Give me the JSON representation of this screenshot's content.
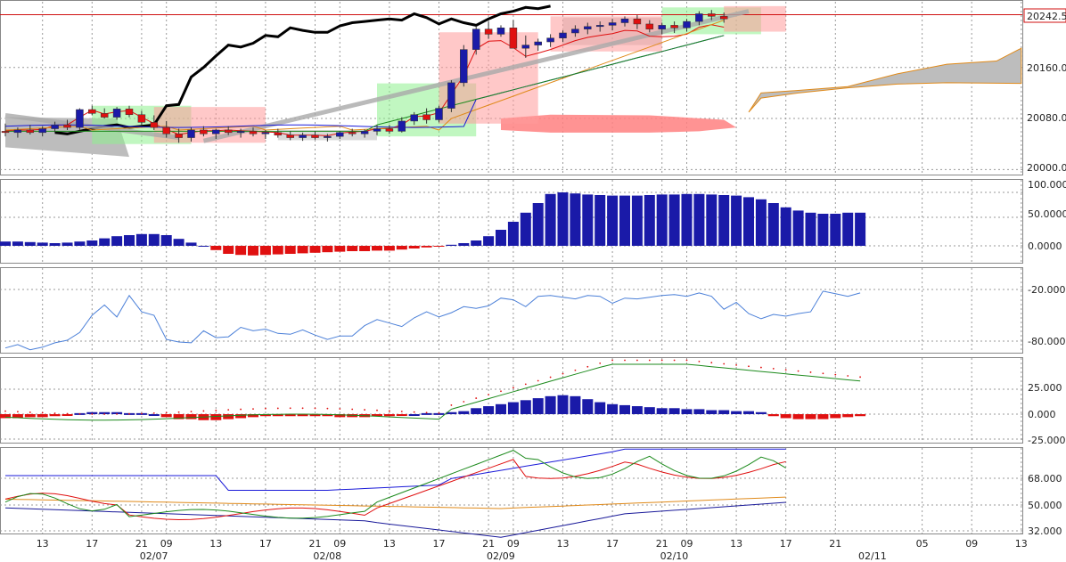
{
  "colors": {
    "up_bar": "#1a1aa8",
    "down_bar": "#e01010",
    "grid": "#9a9a9a",
    "price_line": "#000000",
    "current_price_line": "#d01010",
    "cloud_gray": "#bdbdbd",
    "cloud_red": "#ff8080",
    "box_green": "#8ef08e",
    "box_red": "#ff9a9a",
    "box_gray": "#bcbcbc",
    "osc_line": "#4a7fd8",
    "green_line": "#1c8a1c",
    "red_line": "#e01010",
    "orange_line": "#e08a1a",
    "blue_line": "#1a1ad8"
  },
  "price_scale": {
    "labels": [
      "20242.5",
      "20160.0",
      "20080.0",
      "20000.0"
    ],
    "current_price": "20242.5"
  },
  "time_axis": {
    "ticks": [
      {
        "idx": 3,
        "label": "13"
      },
      {
        "idx": 7,
        "label": "17"
      },
      {
        "idx": 11,
        "label": "21"
      },
      {
        "idx": 13,
        "label": "09"
      },
      {
        "idx": 17,
        "label": "13"
      },
      {
        "idx": 21,
        "label": "17"
      },
      {
        "idx": 25,
        "label": "21"
      },
      {
        "idx": 27,
        "label": "09"
      },
      {
        "idx": 31,
        "label": "13"
      },
      {
        "idx": 35,
        "label": "17"
      },
      {
        "idx": 39,
        "label": "21"
      },
      {
        "idx": 41,
        "label": "09"
      },
      {
        "idx": 45,
        "label": "13"
      },
      {
        "idx": 49,
        "label": "17"
      },
      {
        "idx": 53,
        "label": "21"
      },
      {
        "idx": 55,
        "label": "09"
      },
      {
        "idx": 59,
        "label": "13"
      },
      {
        "idx": 63,
        "label": "17"
      },
      {
        "idx": 67,
        "label": "21"
      },
      {
        "idx": 74,
        "label": "05"
      },
      {
        "idx": 78,
        "label": "09"
      },
      {
        "idx": 82,
        "label": "13"
      }
    ],
    "dates": [
      {
        "idx": 12,
        "label": "02/07"
      },
      {
        "idx": 26,
        "label": "02/08"
      },
      {
        "idx": 40,
        "label": "02/09"
      },
      {
        "idx": 54,
        "label": "02/10"
      },
      {
        "idx": 70,
        "label": "02/11"
      }
    ]
  },
  "panels": {
    "macd_hist": {
      "labels": [
        "100.000",
        "50.0000",
        "0.0000"
      ]
    },
    "williams": {
      "labels": [
        "-20.000",
        "-80.000"
      ]
    },
    "dmi": {
      "labels": [
        "25.000",
        "0.000",
        "-25.000"
      ]
    },
    "rsi_multi": {
      "labels": [
        "68.000",
        "50.000",
        "32.000"
      ]
    }
  },
  "chart_data": [
    {
      "type": "candlestick",
      "y_range": [
        19995,
        20260
      ],
      "current_price": 20242.5,
      "ohlc": [
        [
          20060,
          20072,
          20052,
          20058
        ],
        [
          20058,
          20066,
          20050,
          20062
        ],
        [
          20062,
          20070,
          20055,
          20058
        ],
        [
          20058,
          20068,
          20052,
          20064
        ],
        [
          20064,
          20075,
          20058,
          20070
        ],
        [
          20070,
          20078,
          20062,
          20066
        ],
        [
          20066,
          20096,
          20062,
          20094
        ],
        [
          20094,
          20100,
          20085,
          20088
        ],
        [
          20088,
          20096,
          20080,
          20082
        ],
        [
          20082,
          20098,
          20078,
          20095
        ],
        [
          20095,
          20100,
          20082,
          20086
        ],
        [
          20086,
          20092,
          20070,
          20074
        ],
        [
          20074,
          20085,
          20062,
          20066
        ],
        [
          20066,
          20076,
          20050,
          20056
        ],
        [
          20056,
          20064,
          20042,
          20050
        ],
        [
          20050,
          20066,
          20044,
          20062
        ],
        [
          20062,
          20068,
          20052,
          20056
        ],
        [
          20056,
          20064,
          20048,
          20062
        ],
        [
          20062,
          20068,
          20054,
          20058
        ],
        [
          20058,
          20064,
          20050,
          20060
        ],
        [
          20060,
          20066,
          20052,
          20056
        ],
        [
          20056,
          20062,
          20048,
          20058
        ],
        [
          20058,
          20064,
          20050,
          20054
        ],
        [
          20054,
          20060,
          20046,
          20050
        ],
        [
          20050,
          20058,
          20045,
          20054
        ],
        [
          20054,
          20060,
          20047,
          20050
        ],
        [
          20050,
          20056,
          20044,
          20052
        ],
        [
          20052,
          20060,
          20048,
          20058
        ],
        [
          20058,
          20064,
          20052,
          20056
        ],
        [
          20056,
          20063,
          20050,
          20060
        ],
        [
          20060,
          20070,
          20054,
          20064
        ],
        [
          20064,
          20070,
          20056,
          20060
        ],
        [
          20060,
          20082,
          20058,
          20076
        ],
        [
          20076,
          20090,
          20070,
          20086
        ],
        [
          20086,
          20096,
          20072,
          20078
        ],
        [
          20078,
          20100,
          20074,
          20096
        ],
        [
          20096,
          20140,
          20090,
          20136
        ],
        [
          20136,
          20195,
          20130,
          20188
        ],
        [
          20188,
          20225,
          20180,
          20220
        ],
        [
          20220,
          20232,
          20205,
          20212
        ],
        [
          20212,
          20226,
          20208,
          20222
        ],
        [
          20222,
          20234,
          20205,
          20190
        ],
        [
          20190,
          20210,
          20175,
          20195
        ],
        [
          20195,
          20205,
          20186,
          20200
        ],
        [
          20200,
          20212,
          20192,
          20206
        ],
        [
          20206,
          20218,
          20200,
          20214
        ],
        [
          20214,
          20226,
          20208,
          20220
        ],
        [
          20220,
          20230,
          20212,
          20224
        ],
        [
          20224,
          20232,
          20216,
          20226
        ],
        [
          20226,
          20236,
          20218,
          20230
        ],
        [
          20230,
          20240,
          20224,
          20236
        ],
        [
          20236,
          20242,
          20220,
          20228
        ],
        [
          20228,
          20234,
          20215,
          20220
        ],
        [
          20220,
          20230,
          20212,
          20226
        ],
        [
          20226,
          20232,
          20214,
          20222
        ],
        [
          20222,
          20236,
          20216,
          20232
        ],
        [
          20232,
          20248,
          20226,
          20244
        ],
        [
          20244,
          20250,
          20234,
          20240
        ],
        [
          20240,
          20246,
          20230,
          20236
        ]
      ]
    },
    {
      "type": "bar",
      "name_ref": "macd_hist",
      "y_range": [
        -25,
        105
      ],
      "values": [
        8,
        8,
        7,
        6,
        5,
        6,
        8,
        10,
        14,
        18,
        20,
        22,
        22,
        20,
        13,
        6,
        0,
        -8,
        -15,
        -17,
        -18,
        -17,
        -16,
        -15,
        -14,
        -13,
        -12,
        -11,
        -10,
        -10,
        -9,
        -9,
        -7,
        -5,
        -3,
        -1,
        2,
        5,
        10,
        18,
        30,
        45,
        62,
        80,
        97,
        100,
        98,
        96,
        95,
        94,
        94,
        94,
        95,
        96,
        96,
        97,
        97,
        96,
        95,
        94,
        91,
        87,
        80,
        72,
        66,
        62,
        60,
        60,
        62,
        62
      ]
    },
    {
      "type": "line",
      "name_ref": "williams",
      "y_range": [
        -95,
        -5
      ],
      "values": [
        -88,
        -84,
        -90,
        -87,
        -82,
        -79,
        -70,
        -50,
        -38,
        -52,
        -27,
        -46,
        -50,
        -78,
        -81,
        -82,
        -68,
        -76,
        -75,
        -64,
        -68,
        -66,
        -71,
        -72,
        -67,
        -73,
        -78,
        -74,
        -74,
        -62,
        -55,
        -59,
        -63,
        -53,
        -46,
        -52,
        -47,
        -40,
        -42,
        -39,
        -30,
        -32,
        -40,
        -28,
        -27,
        -29,
        -31,
        -27,
        -28,
        -36,
        -30,
        -31,
        -29,
        -27,
        -26,
        -28,
        -24,
        -28,
        -43,
        -35,
        -48,
        -54,
        -49,
        -51,
        -48,
        -46,
        -22,
        -25,
        -28,
        -24
      ]
    },
    {
      "type": "bar+line",
      "name_ref": "dmi",
      "y_range": [
        -28,
        60
      ],
      "hist": [
        -4,
        -4,
        -3,
        -3,
        -2,
        -1,
        1,
        2,
        2,
        2,
        1,
        1,
        0,
        -3,
        -5,
        -5,
        -6,
        -6,
        -5,
        -4,
        -3,
        -2,
        -2,
        -2,
        -2,
        -2,
        -2,
        -3,
        -3,
        -3,
        -2,
        -2,
        -1,
        0,
        1,
        1,
        2,
        3,
        6,
        8,
        10,
        12,
        14,
        16,
        18,
        19,
        18,
        15,
        12,
        10,
        9,
        8,
        7,
        6,
        6,
        5,
        5,
        4,
        4,
        3,
        3,
        2,
        -2,
        -4,
        -5,
        -5,
        -5,
        -4,
        -3,
        -2
      ]
    }
  ]
}
